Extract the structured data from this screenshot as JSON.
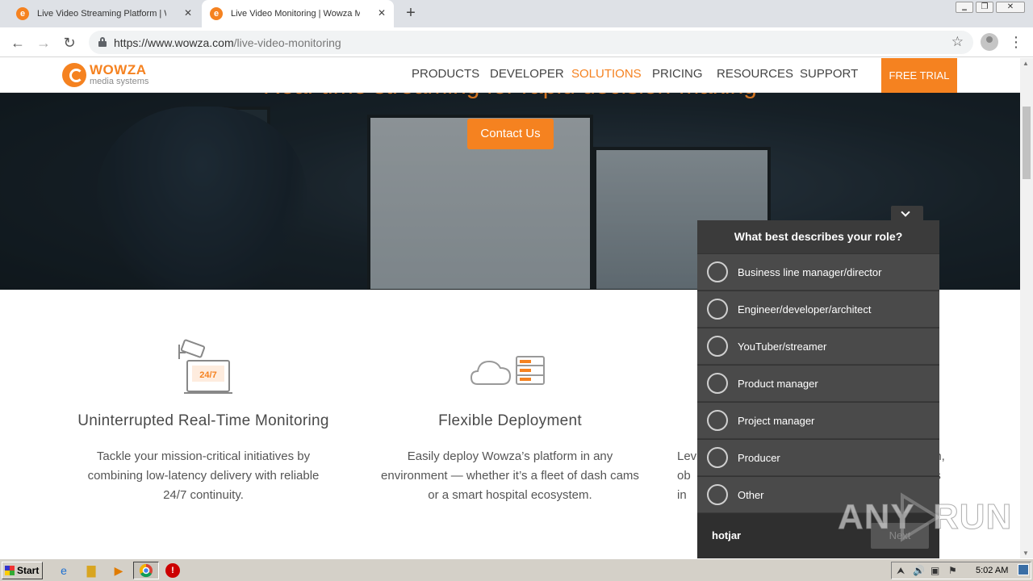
{
  "browser": {
    "tabs": [
      {
        "title": "Live Video Streaming Platform | Wowza",
        "favicon": "wowza-favicon",
        "active": false
      },
      {
        "title": "Live Video Monitoring | Wowza Media",
        "favicon": "wowza-favicon",
        "active": true
      }
    ],
    "new_tab_icon": "+",
    "address": {
      "host": "https://www.wowza.com",
      "path": "/live-video-monitoring"
    }
  },
  "site": {
    "logo": {
      "name": "WOWZA",
      "tagline": "media systems"
    },
    "nav": [
      "PRODUCTS",
      "DEVELOPER",
      "SOLUTIONS",
      "PRICING",
      "RESOURCES",
      "SUPPORT"
    ],
    "active_nav": "SOLUTIONS",
    "cta": "FREE TRIAL",
    "accent": "#f58220"
  },
  "hero": {
    "headline": "Real-time streaming for rapid decision-making",
    "button": "Contact Us"
  },
  "features": [
    {
      "icon": "surveillance-camera-icon",
      "icon_text": "24/7",
      "title": "Uninterrupted Real-Time Monitoring",
      "lines": [
        "Tackle your mission-critical initiatives by",
        "combining low-latency delivery with reliable",
        "24/7 continuity."
      ]
    },
    {
      "icon": "cloud-server-icon",
      "title": "Flexible Deployment",
      "lines": [
        "Easily deploy Wowza’s platform in any",
        "environment — whether it’s a fleet of dash cams",
        "or a smart hospital ecosystem."
      ]
    },
    {
      "partial_lines": [
        "Lev",
        "on,",
        "ob",
        "es",
        "in",
        "s."
      ]
    }
  ],
  "survey": {
    "question": "What best describes your role?",
    "options": [
      "Business line manager/director",
      "Engineer/developer/architect",
      "YouTuber/streamer",
      "Product manager",
      "Project manager",
      "Producer",
      "Other"
    ],
    "brand": "hotjar",
    "next": "Next"
  },
  "watermark": {
    "left": "ANY",
    "right": "RUN"
  },
  "taskbar": {
    "start": "Start",
    "clock": "5:02 AM"
  }
}
